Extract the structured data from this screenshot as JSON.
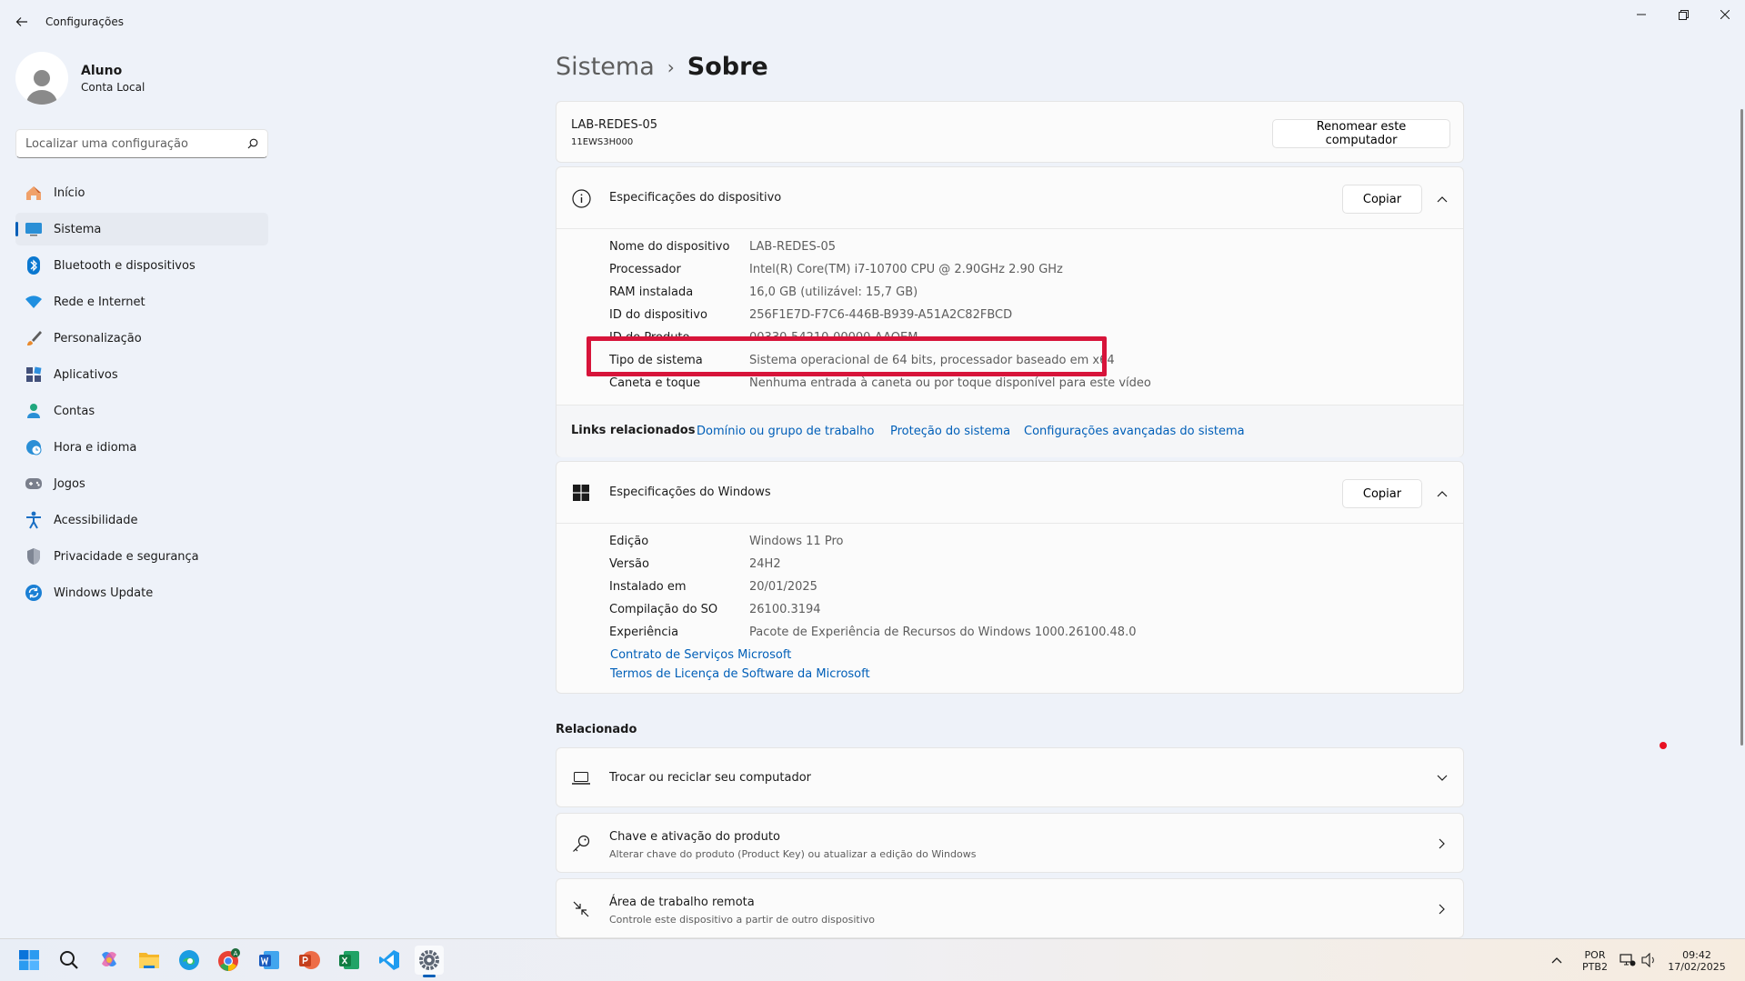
{
  "window": {
    "title": "Configurações"
  },
  "user": {
    "name": "Aluno",
    "account_type": "Conta Local"
  },
  "search": {
    "placeholder": "Localizar uma configuração"
  },
  "sidebar": {
    "items": [
      {
        "label": "Início"
      },
      {
        "label": "Sistema"
      },
      {
        "label": "Bluetooth e dispositivos"
      },
      {
        "label": "Rede e Internet"
      },
      {
        "label": "Personalização"
      },
      {
        "label": "Aplicativos"
      },
      {
        "label": "Contas"
      },
      {
        "label": "Hora e idioma"
      },
      {
        "label": "Jogos"
      },
      {
        "label": "Acessibilidade"
      },
      {
        "label": "Privacidade e segurança"
      },
      {
        "label": "Windows Update"
      }
    ]
  },
  "breadcrumb": {
    "parent": "Sistema",
    "current": "Sobre"
  },
  "computer": {
    "name": "LAB-REDES-05",
    "model": "11EWS3H000",
    "rename_label": "Renomear este computador"
  },
  "device_specs": {
    "title": "Especificações do dispositivo",
    "copy_label": "Copiar",
    "rows": [
      {
        "label": "Nome do dispositivo",
        "value": "LAB-REDES-05"
      },
      {
        "label": "Processador",
        "value": "Intel(R) Core(TM) i7-10700 CPU @ 2.90GHz   2.90 GHz"
      },
      {
        "label": "RAM instalada",
        "value": "16,0 GB (utilizável: 15,7 GB)"
      },
      {
        "label": "ID do dispositivo",
        "value": "256F1E7D-F7C6-446B-B939-A51A2C82FBCD"
      },
      {
        "label": "ID do Produto",
        "value": "00330-54210-00000-AAOEM"
      },
      {
        "label": "Tipo de sistema",
        "value": "Sistema operacional de 64 bits, processador baseado em x64"
      },
      {
        "label": "Caneta e toque",
        "value": "Nenhuma entrada à caneta ou por toque disponível para este vídeo"
      }
    ]
  },
  "related_links": {
    "label": "Links relacionados",
    "links": [
      "Domínio ou grupo de trabalho",
      "Proteção do sistema",
      "Configurações avançadas do sistema"
    ]
  },
  "windows_specs": {
    "title": "Especificações do Windows",
    "copy_label": "Copiar",
    "rows": [
      {
        "label": "Edição",
        "value": "Windows 11 Pro"
      },
      {
        "label": "Versão",
        "value": "24H2"
      },
      {
        "label": "Instalado em",
        "value": "20/01/2025"
      },
      {
        "label": "Compilação do SO",
        "value": "26100.3194"
      },
      {
        "label": "Experiência",
        "value": "Pacote de Experiência de Recursos do Windows 1000.26100.48.0"
      }
    ],
    "links": [
      "Contrato de Serviços Microsoft",
      "Termos de Licença de Software da Microsoft"
    ]
  },
  "related": {
    "title": "Relacionado",
    "items": [
      {
        "title": "Trocar ou reciclar seu computador",
        "subtitle": ""
      },
      {
        "title": "Chave e ativação do produto",
        "subtitle": "Alterar chave do produto (Product Key) ou atualizar a edição do Windows"
      },
      {
        "title": "Área de trabalho remota",
        "subtitle": "Controle este dispositivo a partir de outro dispositivo"
      }
    ]
  },
  "taskbar": {
    "language": "POR",
    "layout": "PTB2",
    "time": "09:42",
    "date": "17/02/2025",
    "apps": [
      "start-icon",
      "search-icon",
      "copilot-icon",
      "file-explorer-icon",
      "edge-icon",
      "chrome-icon",
      "word-icon",
      "powerpoint-icon",
      "excel-icon",
      "vscode-icon",
      "settings-icon"
    ]
  },
  "colors": {
    "accent": "#005fb8",
    "highlight": "#d7143a",
    "background": "#eef2f9"
  }
}
